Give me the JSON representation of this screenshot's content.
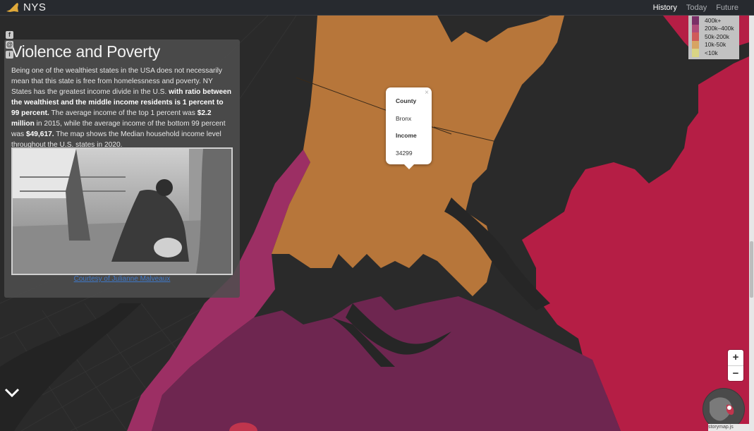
{
  "app": {
    "title": "NYS"
  },
  "nav": {
    "items": [
      "History",
      "Today",
      "Future"
    ],
    "active": "History"
  },
  "panel": {
    "title": "Violence and Poverty",
    "paragraph": [
      {
        "text": "Being one of the wealthiest states in the USA does not necessarily mean that this state is free from homelessness and poverty. NY States has the greatest income divide in the U.S. ",
        "bold": false
      },
      {
        "text": "with ratio between the wealthiest and the middle income residents is 1 percent to 99 percent.",
        "bold": true
      },
      {
        "text": " The average income of the top 1 percent was ",
        "bold": false
      },
      {
        "text": "$2.2 million",
        "bold": true
      },
      {
        "text": " in 2015, while the average income of the bottom 99 percent was ",
        "bold": false
      },
      {
        "text": "$49,617.",
        "bold": true
      },
      {
        "text": " The map shows the Median household income level throughout the U.S. states in 2020.",
        "bold": false
      }
    ],
    "photo_credit": "Courtesy of Julianne Malveaux"
  },
  "share": {
    "icons": [
      "facebook-icon",
      "email-icon",
      "info-icon"
    ]
  },
  "popup": {
    "close": "×",
    "county_label": "County",
    "county_value": "Bronx",
    "income_label": "Income",
    "income_value": "34299"
  },
  "legend": {
    "items": [
      {
        "label": "400k+",
        "color": "#7a2e66"
      },
      {
        "label": "200k–400k",
        "color": "#b04a79"
      },
      {
        "label": "50k-200k",
        "color": "#cf5a5a"
      },
      {
        "label": "10k-50k",
        "color": "#d7a463"
      },
      {
        "label": "<10k",
        "color": "#d9d484"
      }
    ]
  },
  "map_colors": {
    "base": "#2a2a2a",
    "bronx": "#b7763a",
    "brooklyn": "#6e2650",
    "queens": "#b51e45",
    "magenta": "#9c2f64",
    "water": "#262626"
  },
  "zoom": {
    "in": "+",
    "out": "−"
  },
  "attribution": "storymap.js"
}
